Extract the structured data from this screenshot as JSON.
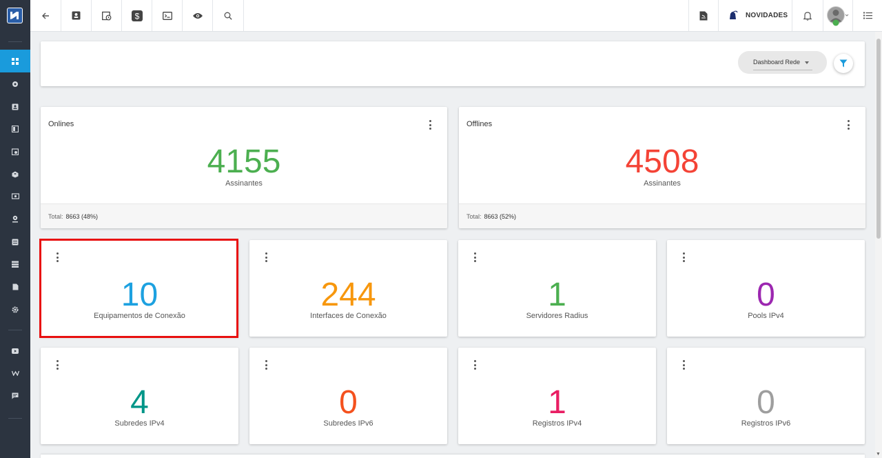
{
  "topbar": {
    "novidades_label": "NOVIDADES"
  },
  "filter": {
    "selected": "Dashboard Rede"
  },
  "summary": [
    {
      "title": "Onlines",
      "value": "4155",
      "sublabel": "Assinantes",
      "total_label": "Total:",
      "total_value": "8663 (48%)",
      "color": "#4caf50"
    },
    {
      "title": "Offlines",
      "value": "4508",
      "sublabel": "Assinantes",
      "total_label": "Total:",
      "total_value": "8663 (52%)",
      "color": "#f44336"
    }
  ],
  "stats": [
    {
      "value": "10",
      "label": "Equipamentos de Conexão",
      "color": "#1da1e0"
    },
    {
      "value": "244",
      "label": "Interfaces de Conexão",
      "color": "#f7970d"
    },
    {
      "value": "1",
      "label": "Servidores Radius",
      "color": "#4caf50"
    },
    {
      "value": "0",
      "label": "Pools IPv4",
      "color": "#9c27b0"
    },
    {
      "value": "4",
      "label": "Subredes IPv4",
      "color": "#009688"
    },
    {
      "value": "0",
      "label": "Subredes IPv6",
      "color": "#f4511e"
    },
    {
      "value": "1",
      "label": "Registros IPv4",
      "color": "#e91e63"
    },
    {
      "value": "0",
      "label": "Registros IPv6",
      "color": "#9e9e9e"
    }
  ],
  "colors": {
    "accent": "#1a9bdc",
    "sidebar": "#2c3440",
    "highlight": "#e80f0f"
  },
  "icons": {
    "sidebar": [
      "dashboard-icon",
      "network-icon",
      "contacts-icon",
      "board-icon",
      "calendar-icon",
      "box-icon",
      "money-icon",
      "location-icon",
      "list-icon",
      "rows-icon",
      "document-icon",
      "settings-icon",
      "youtube-icon",
      "wiki-icon",
      "chat-icon"
    ],
    "topbar": [
      "back-arrow-icon",
      "contact-card-icon",
      "calendar-clock-icon",
      "dollar-icon",
      "terminal-icon",
      "eye-icon",
      "search-icon",
      "pdf-icon",
      "bell-novidades-icon",
      "notification-bell-icon",
      "user-avatar-icon",
      "menu-list-icon"
    ]
  }
}
